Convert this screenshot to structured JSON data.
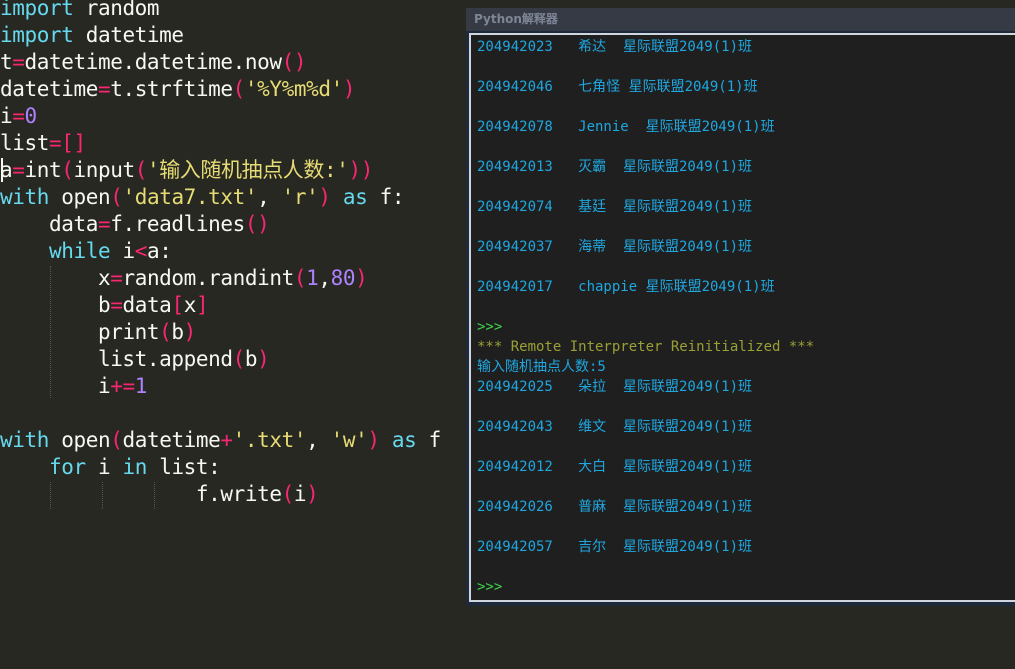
{
  "editor": {
    "lines": [
      [
        {
          "t": "import",
          "c": "kw"
        },
        {
          "t": " random",
          "c": "fn"
        }
      ],
      [
        {
          "t": "import",
          "c": "kw"
        },
        {
          "t": " datetime",
          "c": "fn"
        }
      ],
      [
        {
          "t": "t",
          "c": "fn"
        },
        {
          "t": "=",
          "c": "op"
        },
        {
          "t": "datetime.datetime.now",
          "c": "fn"
        },
        {
          "t": "()",
          "c": "op"
        }
      ],
      [
        {
          "t": "datetime",
          "c": "fn"
        },
        {
          "t": "=",
          "c": "op"
        },
        {
          "t": "t.strftime",
          "c": "fn"
        },
        {
          "t": "(",
          "c": "op"
        },
        {
          "t": "'%Y%m%d'",
          "c": "str"
        },
        {
          "t": ")",
          "c": "op"
        }
      ],
      [
        {
          "t": "i",
          "c": "fn"
        },
        {
          "t": "=",
          "c": "op"
        },
        {
          "t": "0",
          "c": "num"
        }
      ],
      [
        {
          "t": "list",
          "c": "fn"
        },
        {
          "t": "=[]",
          "c": "op"
        }
      ],
      [
        {
          "t": "a",
          "c": "fn"
        },
        {
          "t": "=",
          "c": "op"
        },
        {
          "t": "int",
          "c": "fn"
        },
        {
          "t": "(",
          "c": "op"
        },
        {
          "t": "input",
          "c": "fn"
        },
        {
          "t": "(",
          "c": "op"
        },
        {
          "t": "'输入随机抽点人数:'",
          "c": "str"
        },
        {
          "t": "))",
          "c": "op"
        }
      ],
      [
        {
          "t": "with",
          "c": "fl"
        },
        {
          "t": " ",
          "c": "fn"
        },
        {
          "t": "open",
          "c": "fn"
        },
        {
          "t": "(",
          "c": "op"
        },
        {
          "t": "'data7.txt'",
          "c": "str"
        },
        {
          "t": ", ",
          "c": "fn"
        },
        {
          "t": "'r'",
          "c": "str"
        },
        {
          "t": ")",
          "c": "op"
        },
        {
          "t": " ",
          "c": "fn"
        },
        {
          "t": "as",
          "c": "fl"
        },
        {
          "t": " f:",
          "c": "fn"
        }
      ],
      [
        {
          "t": "    data",
          "c": "fn"
        },
        {
          "t": "=",
          "c": "op"
        },
        {
          "t": "f.readlines",
          "c": "fn"
        },
        {
          "t": "()",
          "c": "op"
        }
      ],
      [
        {
          "t": "    ",
          "c": "fn"
        },
        {
          "t": "while",
          "c": "fl"
        },
        {
          "t": " i",
          "c": "fn"
        },
        {
          "t": "<",
          "c": "op"
        },
        {
          "t": "a:",
          "c": "fn"
        }
      ],
      [
        {
          "t": "        x",
          "c": "fn"
        },
        {
          "t": "=",
          "c": "op"
        },
        {
          "t": "random.randint",
          "c": "fn"
        },
        {
          "t": "(",
          "c": "op"
        },
        {
          "t": "1",
          "c": "num"
        },
        {
          "t": ",",
          "c": "fn"
        },
        {
          "t": "80",
          "c": "num"
        },
        {
          "t": ")",
          "c": "op"
        }
      ],
      [
        {
          "t": "        b",
          "c": "fn"
        },
        {
          "t": "=",
          "c": "op"
        },
        {
          "t": "data",
          "c": "fn"
        },
        {
          "t": "[",
          "c": "op"
        },
        {
          "t": "x",
          "c": "fn"
        },
        {
          "t": "]",
          "c": "op"
        }
      ],
      [
        {
          "t": "        ",
          "c": "fn"
        },
        {
          "t": "print",
          "c": "fn"
        },
        {
          "t": "(",
          "c": "op"
        },
        {
          "t": "b",
          "c": "fn"
        },
        {
          "t": ")",
          "c": "op"
        }
      ],
      [
        {
          "t": "        list.append",
          "c": "fn"
        },
        {
          "t": "(",
          "c": "op"
        },
        {
          "t": "b",
          "c": "fn"
        },
        {
          "t": ")",
          "c": "op"
        }
      ],
      [
        {
          "t": "        i",
          "c": "fn"
        },
        {
          "t": "+=",
          "c": "op"
        },
        {
          "t": "1",
          "c": "num"
        }
      ],
      [],
      [
        {
          "t": "with",
          "c": "fl"
        },
        {
          "t": " ",
          "c": "fn"
        },
        {
          "t": "open",
          "c": "fn"
        },
        {
          "t": "(",
          "c": "op"
        },
        {
          "t": "datetime",
          "c": "fn"
        },
        {
          "t": "+",
          "c": "op"
        },
        {
          "t": "'.txt'",
          "c": "str"
        },
        {
          "t": ", ",
          "c": "fn"
        },
        {
          "t": "'w'",
          "c": "str"
        },
        {
          "t": ")",
          "c": "op"
        },
        {
          "t": " ",
          "c": "fn"
        },
        {
          "t": "as",
          "c": "fl"
        },
        {
          "t": " f",
          "c": "fn"
        }
      ],
      [
        {
          "t": "    ",
          "c": "fn"
        },
        {
          "t": "for",
          "c": "fl"
        },
        {
          "t": " i ",
          "c": "fn"
        },
        {
          "t": "in",
          "c": "fl"
        },
        {
          "t": " list:",
          "c": "fn"
        }
      ],
      [
        {
          "t": "                f.",
          "c": "fn"
        },
        {
          "t": "write",
          "c": "fn"
        },
        {
          "t": "(",
          "c": "op"
        },
        {
          "t": "i",
          "c": "fn"
        },
        {
          "t": ")",
          "c": "op"
        }
      ]
    ]
  },
  "interpreter": {
    "title": "Python解释器",
    "output": [
      {
        "text": "204942023   希达  星际联盟2049(1)班",
        "kind": "out"
      },
      {
        "text": "",
        "kind": "out"
      },
      {
        "text": "204942046   七角怪 星际联盟2049(1)班",
        "kind": "out"
      },
      {
        "text": "",
        "kind": "out"
      },
      {
        "text": "204942078   Jennie  星际联盟2049(1)班",
        "kind": "out"
      },
      {
        "text": "",
        "kind": "out"
      },
      {
        "text": "204942013   灭霸  星际联盟2049(1)班",
        "kind": "out"
      },
      {
        "text": "",
        "kind": "out"
      },
      {
        "text": "204942074   基廷  星际联盟2049(1)班",
        "kind": "out"
      },
      {
        "text": "",
        "kind": "out"
      },
      {
        "text": "204942037   海蒂  星际联盟2049(1)班",
        "kind": "out"
      },
      {
        "text": "",
        "kind": "out"
      },
      {
        "text": "204942017   chappie 星际联盟2049(1)班",
        "kind": "out"
      },
      {
        "text": "",
        "kind": "out"
      },
      {
        "text": ">>>",
        "kind": "prompt"
      },
      {
        "text": "*** Remote Interpreter Reinitialized ***",
        "kind": "notice"
      },
      {
        "text": "输入随机抽点人数:5",
        "kind": "out"
      },
      {
        "text": "204942025   朵拉  星际联盟2049(1)班",
        "kind": "out"
      },
      {
        "text": "",
        "kind": "out"
      },
      {
        "text": "204942043   维文  星际联盟2049(1)班",
        "kind": "out"
      },
      {
        "text": "",
        "kind": "out"
      },
      {
        "text": "204942012   大白  星际联盟2049(1)班",
        "kind": "out"
      },
      {
        "text": "",
        "kind": "out"
      },
      {
        "text": "204942026   普麻  星际联盟2049(1)班",
        "kind": "out"
      },
      {
        "text": "",
        "kind": "out"
      },
      {
        "text": "204942057   吉尔  星际联盟2049(1)班",
        "kind": "out"
      },
      {
        "text": "",
        "kind": "out"
      },
      {
        "text": ">>>",
        "kind": "prompt"
      }
    ]
  },
  "colors": {
    "editor_bg": "#272822",
    "output_text": "#1fa7e0",
    "prompt": "#3ed64b",
    "notice": "#9ba035"
  }
}
